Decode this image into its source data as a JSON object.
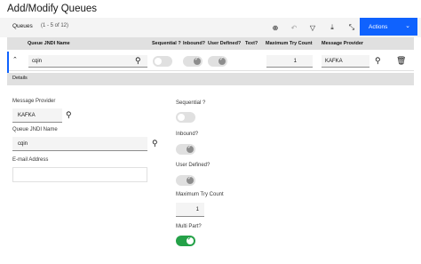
{
  "page": {
    "title": "Add/Modify Queues"
  },
  "toolbar": {
    "title": "Queues",
    "count": "(1 - 5 of 12)",
    "actions_label": "Actions",
    "icons": [
      "add-icon",
      "undo-icon",
      "filter-icon",
      "download-icon",
      "collapse-icon",
      "chevron-down-icon"
    ]
  },
  "table": {
    "columns": [
      "Queue JNDI Name",
      "Sequential ?",
      "Inbound?",
      "User Defined?",
      "Text?",
      "Maximum Try Count",
      "Message Provider"
    ],
    "row": {
      "queue_jndi_name": "cqin",
      "sequential": false,
      "inbound": true,
      "user_defined": true,
      "max_try_count": "1",
      "message_provider": "KAFKA"
    }
  },
  "details": {
    "header": "Details",
    "message_provider_label": "Message Provider",
    "message_provider_value": "KAFKA",
    "queue_jndi_label": "Queue JNDI Name",
    "queue_jndi_value": "cqin",
    "email_label": "E-mail Address",
    "email_value": "",
    "sequential_label": "Sequential ?",
    "inbound_label": "Inbound?",
    "user_defined_label": "User Defined?",
    "max_try_label": "Maximum Try Count",
    "max_try_value": "1",
    "multi_part_label": "Multi Part?",
    "multi_part": true
  },
  "colors": {
    "accent": "#0f62fe",
    "toggle_on": "#24a148",
    "header_bg": "#e0e0e0"
  }
}
